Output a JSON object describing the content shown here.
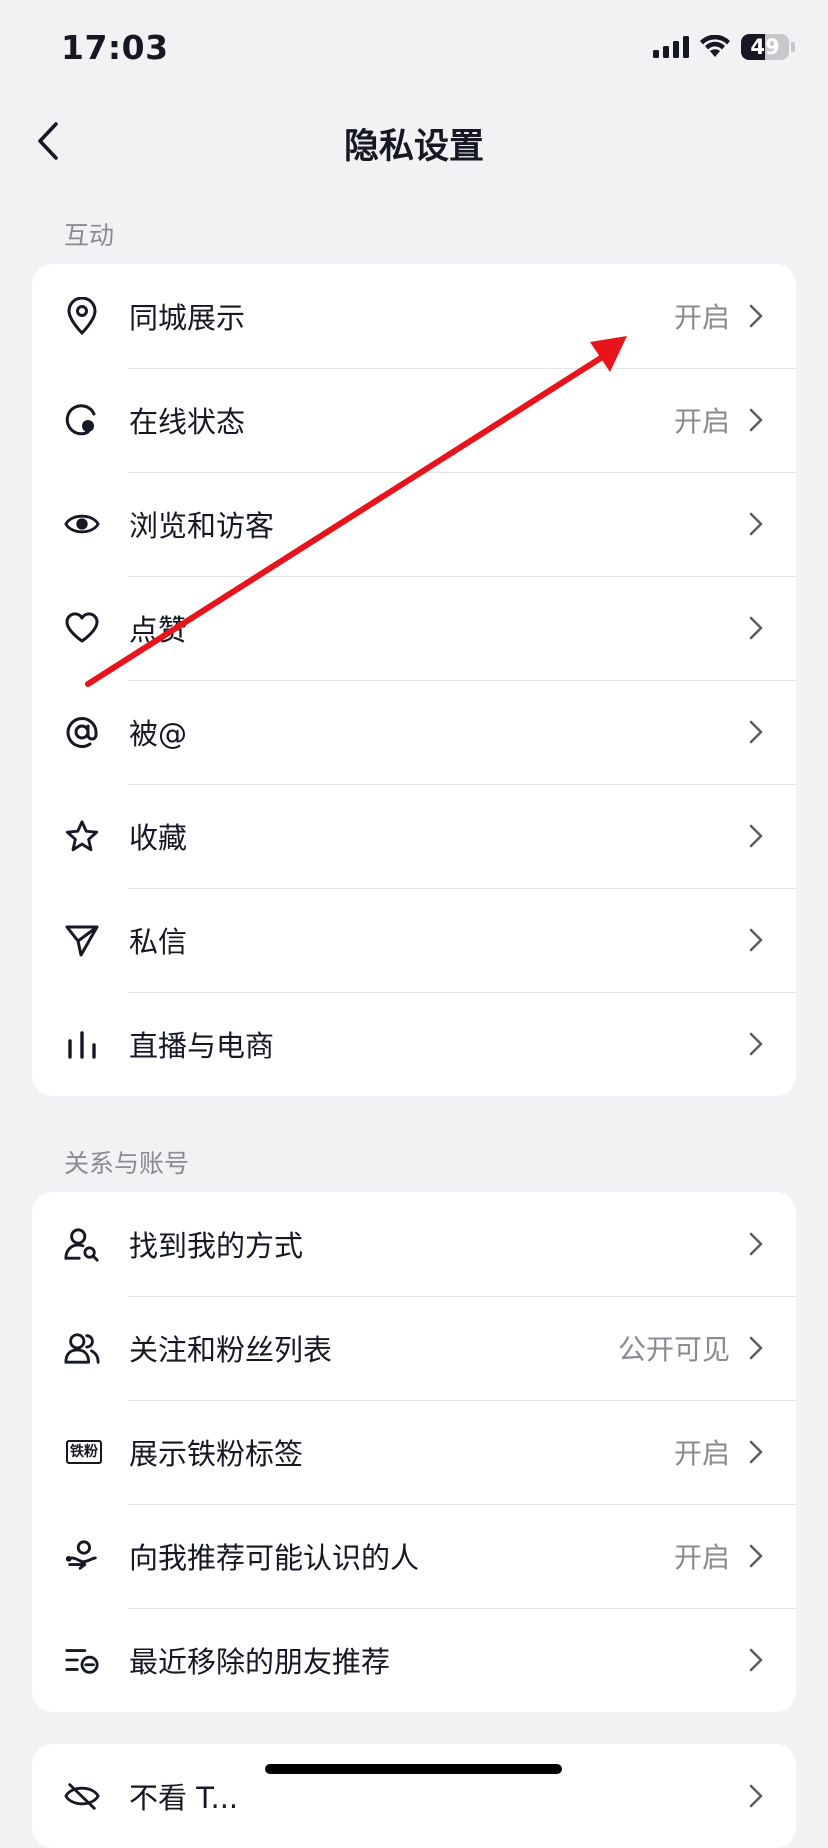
{
  "status_bar": {
    "time": "17:03",
    "battery": "49",
    "battery_level": 0.49
  },
  "nav": {
    "title": "隐私设置"
  },
  "sections": [
    {
      "title": "互动",
      "items": [
        {
          "label": "同城展示",
          "value": "开启",
          "icon": "location-pin-icon"
        },
        {
          "label": "在线状态",
          "value": "开启",
          "icon": "online-status-icon"
        },
        {
          "label": "浏览和访客",
          "value": "",
          "icon": "eye-icon"
        },
        {
          "label": "点赞",
          "value": "",
          "icon": "heart-icon"
        },
        {
          "label": "被@",
          "value": "",
          "icon": "at-sign-icon"
        },
        {
          "label": "收藏",
          "value": "",
          "icon": "star-icon"
        },
        {
          "label": "私信",
          "value": "",
          "icon": "paper-plane-icon"
        },
        {
          "label": "直播与电商",
          "value": "",
          "icon": "bar-chart-icon"
        }
      ]
    },
    {
      "title": "关系与账号",
      "items": [
        {
          "label": "找到我的方式",
          "value": "",
          "icon": "user-search-icon"
        },
        {
          "label": "关注和粉丝列表",
          "value": "公开可见",
          "icon": "users-icon"
        },
        {
          "label": "展示铁粉标签",
          "value": "开启",
          "icon": "fan-badge-icon",
          "badge_text": "铁粉"
        },
        {
          "label": "向我推荐可能认识的人",
          "value": "开启",
          "icon": "recommend-people-icon"
        },
        {
          "label": "最近移除的朋友推荐",
          "value": "",
          "icon": "removed-list-icon"
        }
      ]
    },
    {
      "title": "",
      "items": [
        {
          "label": "不看 T...",
          "value": "",
          "icon": "hide-eye-icon"
        }
      ]
    }
  ],
  "annotation": {
    "type": "red-arrow",
    "color": "#e8141b"
  },
  "colors": {
    "background": "#f2f2f5",
    "card": "#ffffff",
    "text": "#161823",
    "secondary": "#8a8b91",
    "divider": "#e4e4e8"
  }
}
